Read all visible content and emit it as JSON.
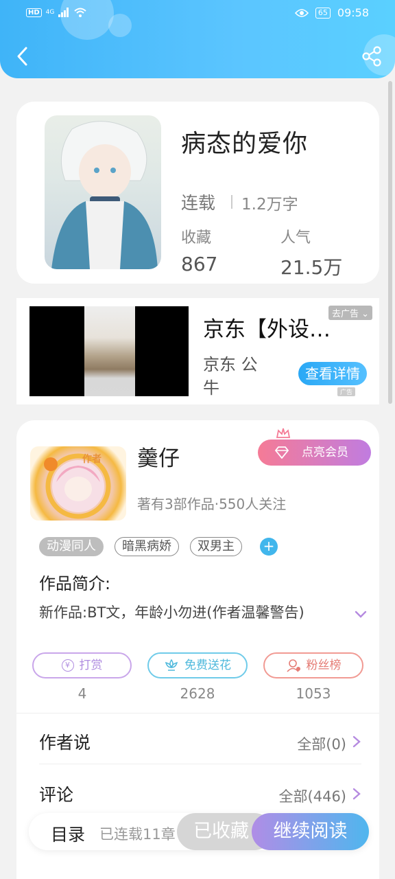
{
  "status_bar": {
    "network_badge": "HD",
    "signal_label": "4G",
    "battery": "65",
    "time": "09:58"
  },
  "book": {
    "title": "病态的爱你",
    "status": "连载",
    "word_count": "1.2万字",
    "favorites_label": "收藏",
    "favorites_value": "867",
    "popularity_label": "人气",
    "popularity_value": "21.5万"
  },
  "ad": {
    "title": "京东【外设…",
    "subtitle": "京东 公牛",
    "remove_ad_label": "去广告",
    "detail_button": "查看详情",
    "ad_mark": "广告"
  },
  "author": {
    "badge": "作者",
    "name": "羹仔",
    "meta": "著有3部作品·550人关注",
    "vip_button": "点亮会员",
    "tags": [
      "动漫同人",
      "暗黑病娇",
      "双男主"
    ],
    "intro_heading": "作品简介:",
    "intro_text": "新作品:BT文，年龄小勿进(作者温馨警告)",
    "actions": [
      {
        "label": "打赏",
        "count": "4",
        "color": "#c9a6ea"
      },
      {
        "label": "免费送花",
        "count": "2628",
        "color": "#6fcbe9"
      },
      {
        "label": "粉丝榜",
        "count": "1053",
        "color": "#f19a93"
      }
    ],
    "author_says": {
      "label": "作者说",
      "link": "全部(0)"
    },
    "comments": {
      "label": "评论",
      "link": "全部(446)"
    }
  },
  "bottom_bar": {
    "menu": "目录",
    "chapters": "已连载11章",
    "favorited": "已收藏",
    "continue": "继续阅读"
  },
  "colors": {
    "header_blue": "#3fb4f8",
    "accent_blue": "#41b6ec",
    "vip_pink": "#f57b96",
    "vip_purple": "#c07ce0"
  }
}
